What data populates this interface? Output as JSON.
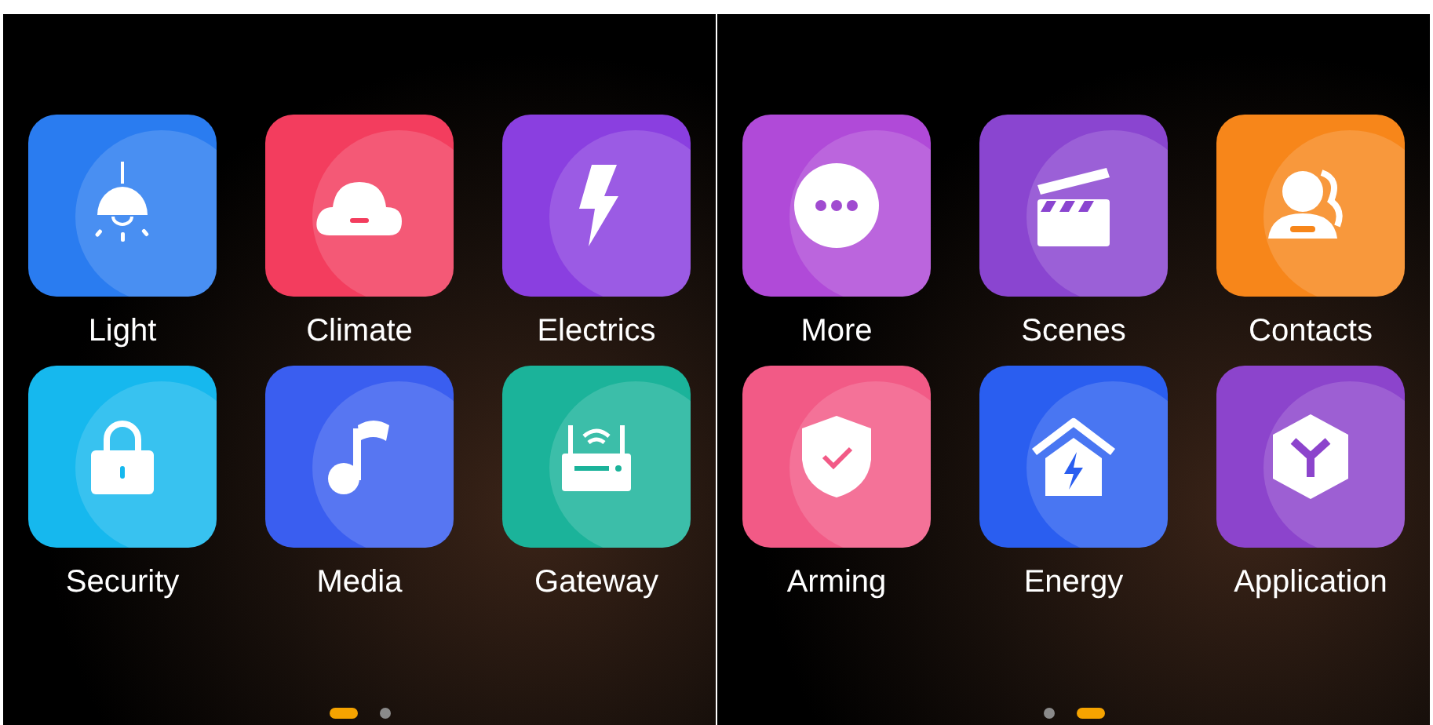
{
  "screens": [
    {
      "apps": [
        {
          "label": "Light",
          "kind": "lamp",
          "color": "#2a7cf0"
        },
        {
          "label": "Climate",
          "kind": "cloud",
          "color": "#f33d5e"
        },
        {
          "label": "Electrics",
          "kind": "bolt",
          "color": "#8a3fe0"
        },
        {
          "label": "Security",
          "kind": "lock",
          "color": "#16b8ee"
        },
        {
          "label": "Media",
          "kind": "music",
          "color": "#3a5ef0"
        },
        {
          "label": "Gateway",
          "kind": "router",
          "color": "#1bb39a"
        }
      ],
      "page_dots": [
        {
          "selected": true
        },
        {
          "selected": false
        }
      ]
    },
    {
      "apps": [
        {
          "label": "More",
          "kind": "dots",
          "color": "#b04ad8"
        },
        {
          "label": "Scenes",
          "kind": "clapper",
          "color": "#8a45d0"
        },
        {
          "label": "Contacts",
          "kind": "contacts",
          "color": "#f7861a"
        },
        {
          "label": "Arming",
          "kind": "shield",
          "color": "#f25a86"
        },
        {
          "label": "Energy",
          "kind": "house",
          "color": "#2a5ef0"
        },
        {
          "label": "Application",
          "kind": "cube",
          "color": "#8c44cc"
        }
      ],
      "page_dots": [
        {
          "selected": false
        },
        {
          "selected": true
        }
      ]
    }
  ]
}
